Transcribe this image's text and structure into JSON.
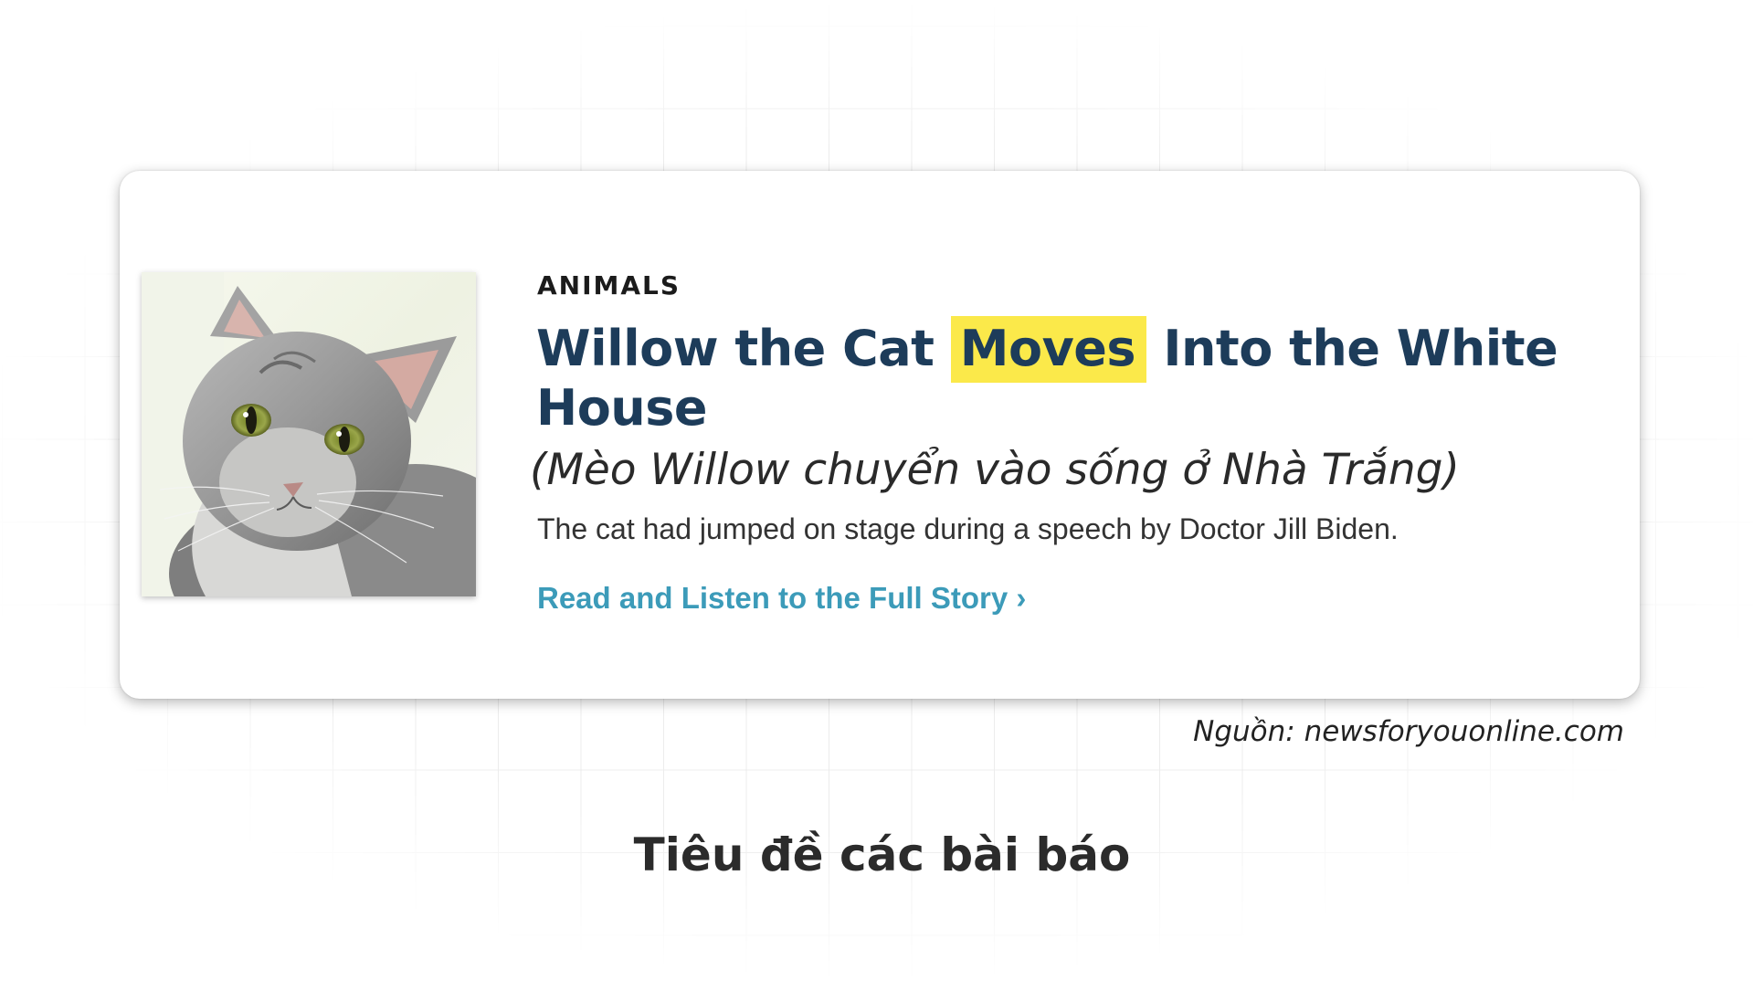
{
  "article_card": {
    "category": "ANIMALS",
    "headline": {
      "before": "Willow the Cat ",
      "highlight": "Moves",
      "after": " Into the White House"
    },
    "translation": "(Mèo Willow chuyển vào sống ở Nhà Trắng)",
    "summary": "The cat had jumped on stage during a speech by Doctor Jill Biden.",
    "read_more": "Read and Listen to the Full Story ›",
    "image_icon": "cat-photo"
  },
  "source": "Nguồn: newsforyouonline.com",
  "section_title": "Tiêu đề các bài báo",
  "colors": {
    "headline": "#1d3c5a",
    "highlight": "#fbe94a",
    "link": "#3c9bb9",
    "grid": "#ececec"
  }
}
